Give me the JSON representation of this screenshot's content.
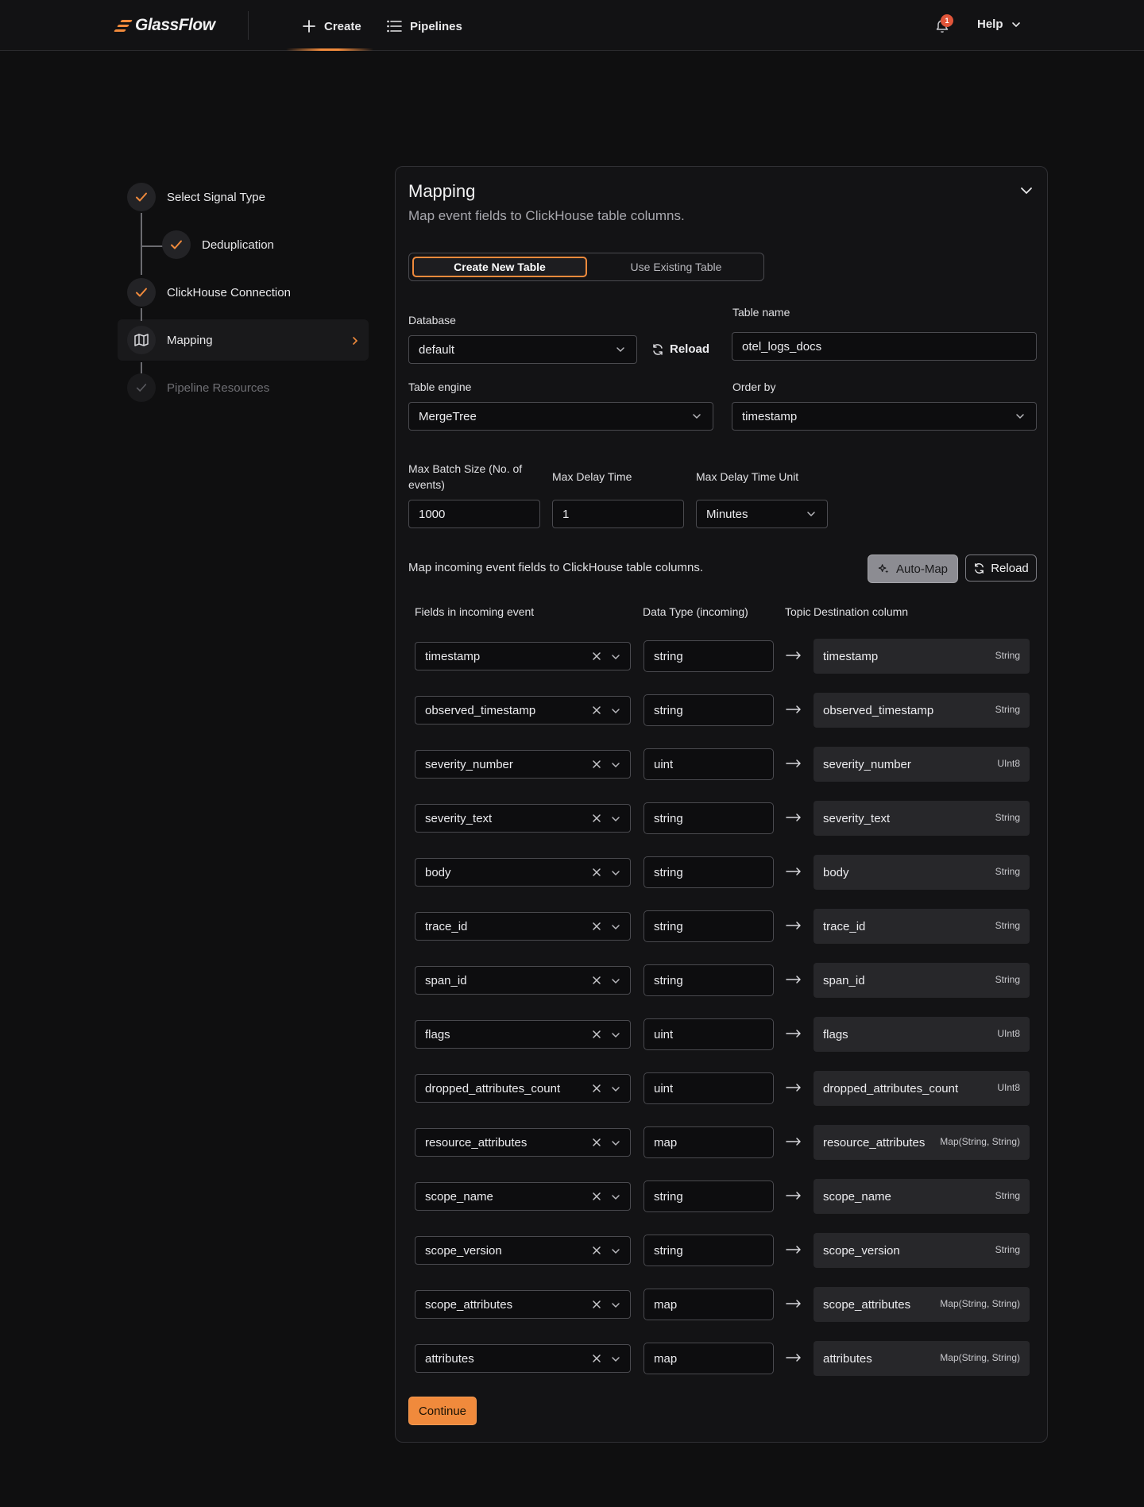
{
  "nav": {
    "logo_text": "GlassFlow",
    "create_label": "Create",
    "pipelines_label": "Pipelines",
    "notifications_count": "1",
    "help_label": "Help"
  },
  "stepper": {
    "steps": [
      {
        "label": "Select Signal Type",
        "state": "done"
      },
      {
        "label": "Deduplication",
        "state": "done"
      },
      {
        "label": "ClickHouse Connection",
        "state": "done"
      },
      {
        "label": "Mapping",
        "state": "active"
      },
      {
        "label": "Pipeline Resources",
        "state": "pending"
      }
    ]
  },
  "card": {
    "title": "Mapping",
    "subtitle": "Map event fields to ClickHouse table columns.",
    "tabs": {
      "create_new": "Create New Table",
      "use_existing": "Use Existing Table"
    },
    "database": {
      "label": "Database",
      "value": "default"
    },
    "reload_label": "Reload",
    "table_name": {
      "label": "Table name",
      "value": "otel_logs_docs"
    },
    "table_engine": {
      "label": "Table engine",
      "value": "MergeTree"
    },
    "order_by": {
      "label": "Order by",
      "value": "timestamp"
    },
    "max_batch": {
      "label": "Max Batch Size (No. of events)",
      "value": "1000"
    },
    "max_delay": {
      "label": "Max Delay Time",
      "value": "1"
    },
    "max_delay_unit": {
      "label": "Max Delay Time Unit",
      "value": "Minutes"
    },
    "mapping_hint": "Map incoming event fields to ClickHouse table columns.",
    "auto_map_label": "Auto-Map",
    "reload_map_label": "Reload",
    "columns": {
      "fields": "Fields in incoming event",
      "dtype": "Data Type (incoming)",
      "topic": "Topic",
      "destination": "Destination column"
    },
    "continue_label": "Continue"
  },
  "mappings": [
    {
      "field": "timestamp",
      "dtype": "string",
      "dest": "timestamp",
      "ch_type": "String"
    },
    {
      "field": "observed_timestamp",
      "dtype": "string",
      "dest": "observed_timestamp",
      "ch_type": "String"
    },
    {
      "field": "severity_number",
      "dtype": "uint",
      "dest": "severity_number",
      "ch_type": "UInt8"
    },
    {
      "field": "severity_text",
      "dtype": "string",
      "dest": "severity_text",
      "ch_type": "String"
    },
    {
      "field": "body",
      "dtype": "string",
      "dest": "body",
      "ch_type": "String"
    },
    {
      "field": "trace_id",
      "dtype": "string",
      "dest": "trace_id",
      "ch_type": "String"
    },
    {
      "field": "span_id",
      "dtype": "string",
      "dest": "span_id",
      "ch_type": "String"
    },
    {
      "field": "flags",
      "dtype": "uint",
      "dest": "flags",
      "ch_type": "UInt8"
    },
    {
      "field": "dropped_attributes_count",
      "dtype": "uint",
      "dest": "dropped_attributes_count",
      "ch_type": "UInt8"
    },
    {
      "field": "resource_attributes",
      "dtype": "map",
      "dest": "resource_attributes",
      "ch_type": "Map(String, String)"
    },
    {
      "field": "scope_name",
      "dtype": "string",
      "dest": "scope_name",
      "ch_type": "String"
    },
    {
      "field": "scope_version",
      "dtype": "string",
      "dest": "scope_version",
      "ch_type": "String"
    },
    {
      "field": "scope_attributes",
      "dtype": "map",
      "dest": "scope_attributes",
      "ch_type": "Map(String, String)"
    },
    {
      "field": "attributes",
      "dtype": "map",
      "dest": "attributes",
      "ch_type": "Map(String, String)"
    }
  ],
  "colors": {
    "accent": "#f08a3c",
    "background": "#0f0f10",
    "card": "#131315"
  }
}
